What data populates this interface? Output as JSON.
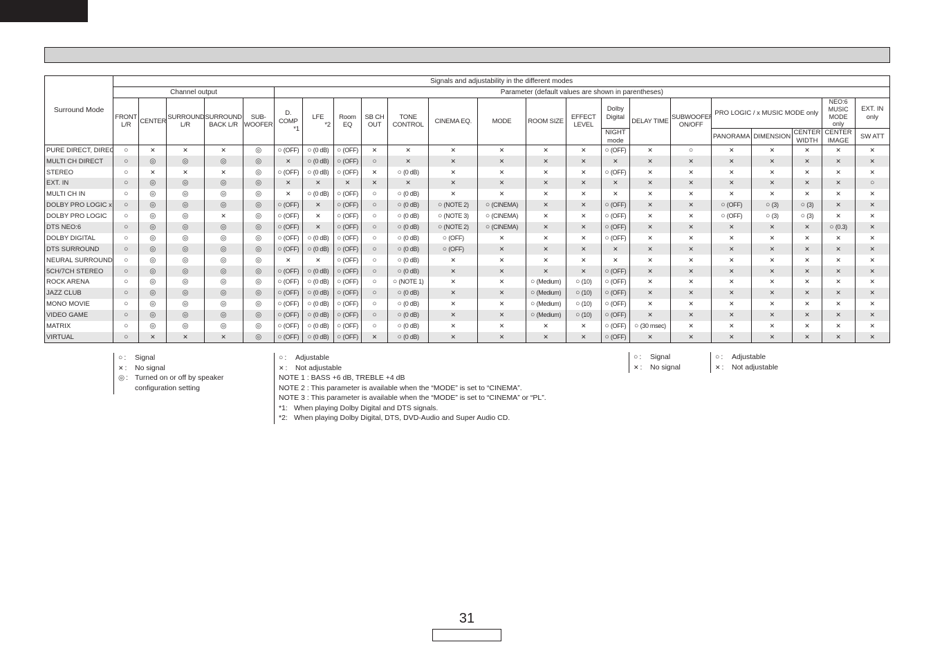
{
  "page": {
    "page_number": "31"
  },
  "table": {
    "corner_header": "Surround Mode",
    "top_header": "Signals and adjustability in the different modes",
    "channel_group": "Channel output",
    "parameter_group": "Parameter (default values are shown in parentheses)",
    "columns": {
      "front": "FRONT L/R",
      "center": "CENTER",
      "surround": "SURROUND L/R",
      "surround_back": "SURROUND BACK L/R",
      "subwoofer": "SUB- WOOFER",
      "dcomp": "D. COMP",
      "dcomp_note": "*1",
      "lfe": "LFE",
      "lfe_note": "*2",
      "room_eq": "Room EQ",
      "sb_ch_out": "SB CH OUT",
      "tone_control": "TONE CONTROL",
      "cinema_eq": "CINEMA EQ.",
      "mode": "MODE",
      "room_size": "ROOM SIZE",
      "effect_level": "EFFECT LEVEL",
      "dolby_digital": "Dolby Digital",
      "night_mode": "NIGHT mode",
      "delay_time": "DELAY TIME",
      "subwoofer_onoff": "SUBWOOFER ON/OFF",
      "pro_logic_group": "PRO LOGIC   /   x MUSIC MODE only",
      "panorama": "PANORAMA",
      "dimension": "DIMENSION",
      "center_width": "CENTER WIDTH",
      "neo6_group": "NEO:6 MUSIC MODE only",
      "center_image": "CENTER IMAGE",
      "ext_in_group": "EXT. IN only",
      "sw_att": "SW ATT"
    },
    "rows": [
      {
        "mode": "PURE DIRECT, DIRECT",
        "cells": [
          "yes",
          "no",
          "no",
          "no",
          "spk",
          "yes:(OFF)",
          "yes:(0 dB)",
          "yes:(OFF)",
          "no",
          "no",
          "no",
          "no",
          "no",
          "no",
          "yes:(OFF)",
          "no",
          "yes",
          "no",
          "no",
          "no",
          "no",
          "no"
        ]
      },
      {
        "mode": "MULTI CH DIRECT",
        "cells": [
          "yes",
          "spk",
          "spk",
          "spk",
          "spk",
          "no",
          "yes:(0 dB)",
          "yes:(OFF)",
          "yes",
          "no",
          "no",
          "no",
          "no",
          "no",
          "no",
          "no",
          "no",
          "no",
          "no",
          "no",
          "no",
          "no"
        ]
      },
      {
        "mode": "STEREO",
        "cells": [
          "yes",
          "no",
          "no",
          "no",
          "spk",
          "yes:(OFF)",
          "yes:(0 dB)",
          "yes:(OFF)",
          "no",
          "yes:(0 dB)",
          "no",
          "no",
          "no",
          "no",
          "yes:(OFF)",
          "no",
          "no",
          "no",
          "no",
          "no",
          "no",
          "no"
        ]
      },
      {
        "mode": "EXT. IN",
        "cells": [
          "yes",
          "spk",
          "spk",
          "spk",
          "spk",
          "no",
          "no",
          "no",
          "no",
          "no",
          "no",
          "no",
          "no",
          "no",
          "no",
          "no",
          "no",
          "no",
          "no",
          "no",
          "no",
          "yes"
        ]
      },
      {
        "mode": "MULTI CH IN",
        "cells": [
          "yes",
          "spk",
          "spk",
          "spk",
          "spk",
          "no",
          "yes:(0 dB)",
          "yes:(OFF)",
          "yes",
          "yes:(0 dB)",
          "no",
          "no",
          "no",
          "no",
          "no",
          "no",
          "no",
          "no",
          "no",
          "no",
          "no",
          "no"
        ]
      },
      {
        "mode": "DOLBY PRO LOGIC   x",
        "cells": [
          "yes",
          "spk",
          "spk",
          "spk",
          "spk",
          "yes:(OFF)",
          "no",
          "yes:(OFF)",
          "yes",
          "yes:(0 dB)",
          "yes:(NOTE 2)",
          "yes:(CINEMA)",
          "no",
          "no",
          "yes:(OFF)",
          "no",
          "no",
          "yes:(OFF)",
          "yes:(3)",
          "yes:(3)",
          "no",
          "no"
        ]
      },
      {
        "mode": "DOLBY PRO LOGIC",
        "cells": [
          "yes",
          "spk",
          "spk",
          "no",
          "spk",
          "yes:(OFF)",
          "no",
          "yes:(OFF)",
          "yes",
          "yes:(0 dB)",
          "yes:(NOTE 3)",
          "yes:(CINEMA)",
          "no",
          "no",
          "yes:(OFF)",
          "no",
          "no",
          "yes:(OFF)",
          "yes:(3)",
          "yes:(3)",
          "no",
          "no"
        ]
      },
      {
        "mode": "DTS NEO:6",
        "cells": [
          "yes",
          "spk",
          "spk",
          "spk",
          "spk",
          "yes:(OFF)",
          "no",
          "yes:(OFF)",
          "yes",
          "yes:(0 dB)",
          "yes:(NOTE 2)",
          "yes:(CINEMA)",
          "no",
          "no",
          "yes:(OFF)",
          "no",
          "no",
          "no",
          "no",
          "no",
          "yes:(0.3)",
          "no"
        ]
      },
      {
        "mode": "DOLBY DIGITAL",
        "cells": [
          "yes",
          "spk",
          "spk",
          "spk",
          "spk",
          "yes:(OFF)",
          "yes:(0 dB)",
          "yes:(OFF)",
          "yes",
          "yes:(0 dB)",
          "yes:(OFF)",
          "no",
          "no",
          "no",
          "yes:(OFF)",
          "no",
          "no",
          "no",
          "no",
          "no",
          "no",
          "no"
        ]
      },
      {
        "mode": "DTS SURROUND",
        "cells": [
          "yes",
          "spk",
          "spk",
          "spk",
          "spk",
          "yes:(OFF)",
          "yes:(0 dB)",
          "yes:(OFF)",
          "yes",
          "yes:(0 dB)",
          "yes:(OFF)",
          "no",
          "no",
          "no",
          "no",
          "no",
          "no",
          "no",
          "no",
          "no",
          "no",
          "no"
        ]
      },
      {
        "mode": "NEURAL SURROUND",
        "cells": [
          "yes",
          "spk",
          "spk",
          "spk",
          "spk",
          "no",
          "no",
          "yes:(OFF)",
          "yes",
          "yes:(0 dB)",
          "no",
          "no",
          "no",
          "no",
          "no",
          "no",
          "no",
          "no",
          "no",
          "no",
          "no",
          "no"
        ]
      },
      {
        "mode": "5CH/7CH STEREO",
        "cells": [
          "yes",
          "spk",
          "spk",
          "spk",
          "spk",
          "yes:(OFF)",
          "yes:(0 dB)",
          "yes:(OFF)",
          "yes",
          "yes:(0 dB)",
          "no",
          "no",
          "no",
          "no",
          "yes:(OFF)",
          "no",
          "no",
          "no",
          "no",
          "no",
          "no",
          "no"
        ]
      },
      {
        "mode": "ROCK ARENA",
        "cells": [
          "yes",
          "spk",
          "spk",
          "spk",
          "spk",
          "yes:(OFF)",
          "yes:(0 dB)",
          "yes:(OFF)",
          "yes",
          "yes:(NOTE 1)",
          "no",
          "no",
          "yes:(Medium)",
          "yes:(10)",
          "yes:(OFF)",
          "no",
          "no",
          "no",
          "no",
          "no",
          "no",
          "no"
        ]
      },
      {
        "mode": "JAZZ CLUB",
        "cells": [
          "yes",
          "spk",
          "spk",
          "spk",
          "spk",
          "yes:(OFF)",
          "yes:(0 dB)",
          "yes:(OFF)",
          "yes",
          "yes:(0 dB)",
          "no",
          "no",
          "yes:(Medium)",
          "yes:(10)",
          "yes:(OFF)",
          "no",
          "no",
          "no",
          "no",
          "no",
          "no",
          "no"
        ]
      },
      {
        "mode": "MONO MOVIE",
        "cells": [
          "yes",
          "spk",
          "spk",
          "spk",
          "spk",
          "yes:(OFF)",
          "yes:(0 dB)",
          "yes:(OFF)",
          "yes",
          "yes:(0 dB)",
          "no",
          "no",
          "yes:(Medium)",
          "yes:(10)",
          "yes:(OFF)",
          "no",
          "no",
          "no",
          "no",
          "no",
          "no",
          "no"
        ]
      },
      {
        "mode": "VIDEO GAME",
        "cells": [
          "yes",
          "spk",
          "spk",
          "spk",
          "spk",
          "yes:(OFF)",
          "yes:(0 dB)",
          "yes:(OFF)",
          "yes",
          "yes:(0 dB)",
          "no",
          "no",
          "yes:(Medium)",
          "yes:(10)",
          "yes:(OFF)",
          "no",
          "no",
          "no",
          "no",
          "no",
          "no",
          "no"
        ]
      },
      {
        "mode": "MATRIX",
        "cells": [
          "yes",
          "spk",
          "spk",
          "spk",
          "spk",
          "yes:(OFF)",
          "yes:(0 dB)",
          "yes:(OFF)",
          "yes",
          "yes:(0 dB)",
          "no",
          "no",
          "no",
          "no",
          "yes:(OFF)",
          "yes:(30 msec)",
          "no",
          "no",
          "no",
          "no",
          "no",
          "no"
        ]
      },
      {
        "mode": "VIRTUAL",
        "cells": [
          "yes",
          "no",
          "no",
          "no",
          "spk",
          "yes:(OFF)",
          "yes:(0 dB)",
          "yes:(OFF)",
          "no",
          "yes:(0 dB)",
          "no",
          "no",
          "no",
          "no",
          "yes:(OFF)",
          "no",
          "no",
          "no",
          "no",
          "no",
          "no",
          "no"
        ]
      }
    ]
  },
  "symbols": {
    "yes": "circle-icon",
    "no": "cross-icon",
    "spk": "double-circle-icon"
  },
  "legend": {
    "channel": [
      {
        "symbol": "yes",
        "label": "Signal"
      },
      {
        "symbol": "no",
        "label": "No signal"
      },
      {
        "symbol": "spk",
        "label": "Turned on or off by speaker",
        "label2": "configuration setting"
      }
    ],
    "parameter": [
      {
        "symbol": "yes",
        "label": "Adjustable"
      },
      {
        "symbol": "no",
        "label": "Not adjustable"
      }
    ],
    "notes": [
      "NOTE 1 : BASS +6 dB, TREBLE +4 dB",
      "NOTE 2 : This parameter is available when the “MODE” is set to “CINEMA”.",
      "NOTE 3 : This parameter is available when the “MODE” is set to “CINEMA” or “PL”."
    ],
    "footnotes": [
      {
        "key": "*1:",
        "text": "When playing Dolby Digital and DTS signals."
      },
      {
        "key": "*2:",
        "text": "When playing Dolby Digital, DTS, DVD-Audio and Super Audio CD."
      }
    ],
    "right_signal": [
      {
        "symbol": "yes",
        "label": "Signal"
      },
      {
        "symbol": "no",
        "label": "No signal"
      }
    ],
    "right_adjust": [
      {
        "symbol": "yes",
        "label": "Adjustable"
      },
      {
        "symbol": "no",
        "label": "Not adjustable"
      }
    ]
  }
}
